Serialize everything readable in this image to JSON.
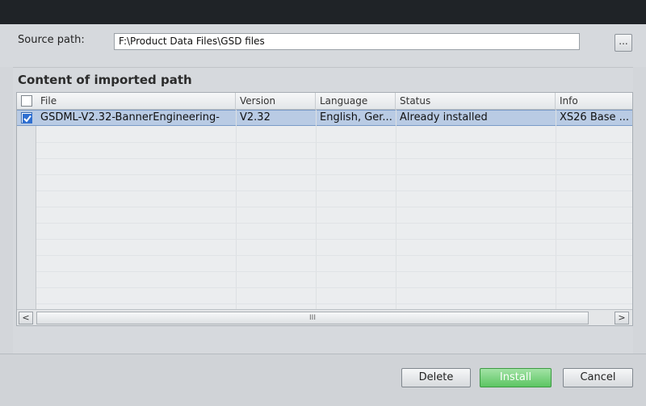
{
  "source": {
    "label": "Source path:",
    "value": "F:\\Product Data Files\\GSD files",
    "browse_label": "..."
  },
  "content": {
    "title": "Content of imported path",
    "columns": [
      "File",
      "Version",
      "Language",
      "Status",
      "Info"
    ],
    "rows": [
      {
        "checked": true,
        "file": "GSDML-V2.32-BannerEngineering-",
        "version": "V2.32",
        "language": "English, Ger...",
        "status": "Already installed",
        "info": "XS26 Base ..."
      }
    ]
  },
  "scrollbar": {
    "left_arrow": "<",
    "right_arrow": ">",
    "thumb_grip": "III"
  },
  "buttons": {
    "delete": "Delete",
    "install": "Install",
    "cancel": "Cancel"
  }
}
